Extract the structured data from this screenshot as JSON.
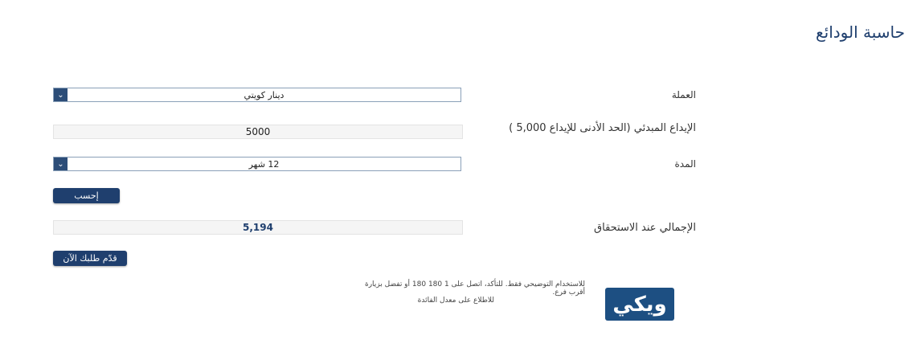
{
  "page": {
    "title": "حاسبة الودائع"
  },
  "currency": {
    "label": "العملة",
    "value": "دينار كويتي"
  },
  "deposit": {
    "label": "الإيداع المبدئي (الحد الأدنى للإيداع 5,000 )",
    "value": "5000"
  },
  "duration": {
    "label": "المدة",
    "value": "12 شهر"
  },
  "calculate": {
    "label": "إحسب"
  },
  "result": {
    "label": "الإجمالي عند الاستحقاق",
    "value": "5,194"
  },
  "apply": {
    "label": "قدّم طلبك الآن"
  },
  "disclaimer": {
    "line1": "للاستخدام التوضيحي فقط. للتأكد، اتصل على 1 180 180 أو تفضل بزيارة أقرب فرع.",
    "line2": "للاطلاع على معدل الفائدة"
  },
  "logo": {
    "text": "ويكي"
  },
  "icons": {
    "dropdown": "chevron-down-icon"
  },
  "colors": {
    "accent": "#1f3f6e",
    "logo_bg": "#1d4f82"
  }
}
